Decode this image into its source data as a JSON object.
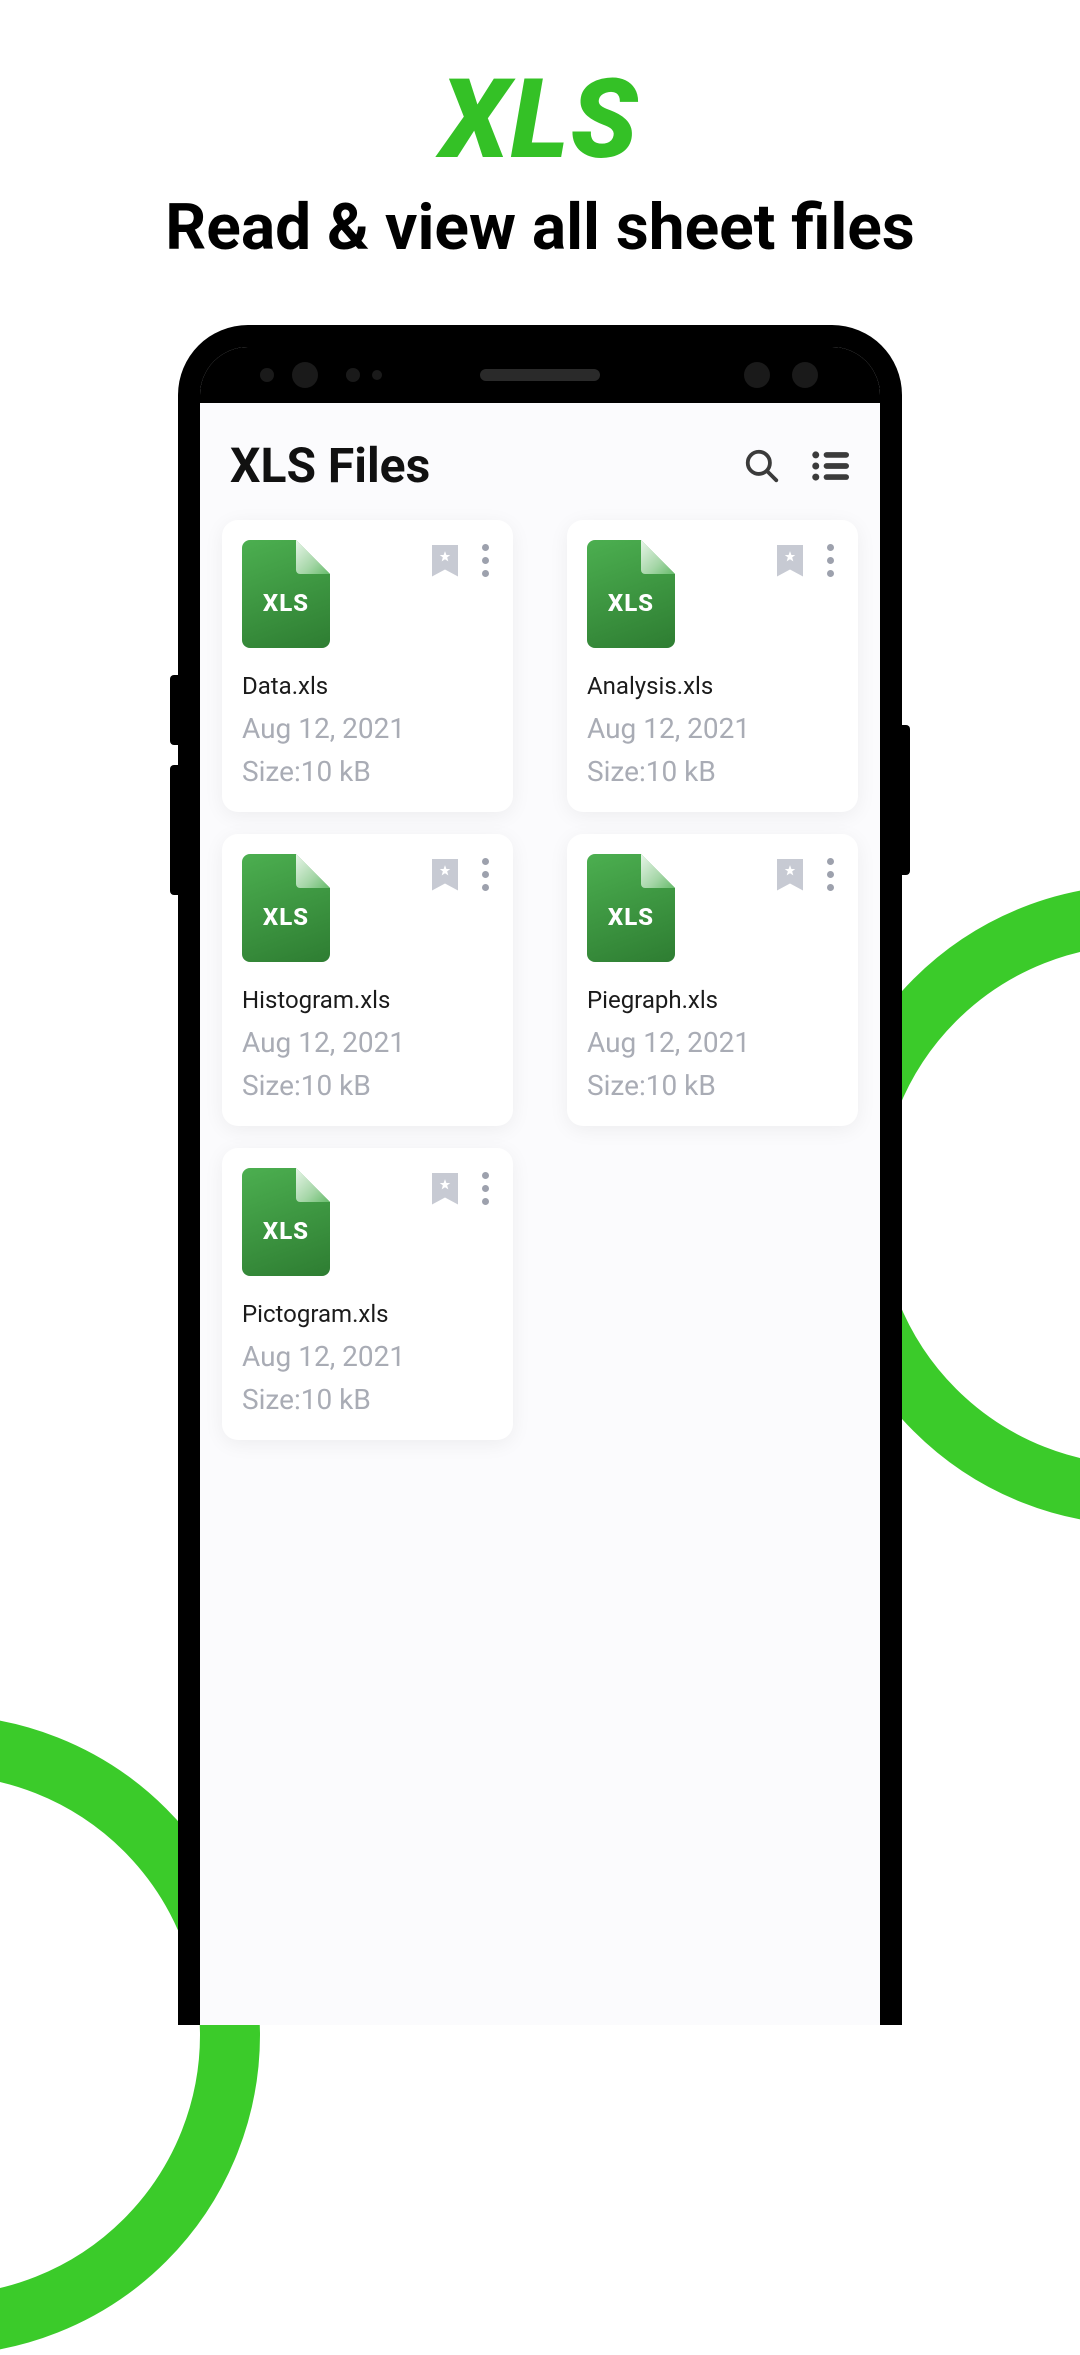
{
  "promo": {
    "title": "XLS",
    "subtitle": "Read & view all sheet files"
  },
  "header": {
    "title": "XLS Files"
  },
  "file_icon_label": "XLS",
  "size_prefix": "Size:",
  "files": [
    {
      "name": "Data.xls",
      "date": "Aug 12, 2021",
      "size": "10 kB"
    },
    {
      "name": "Analysis.xls",
      "date": "Aug 12, 2021",
      "size": "10 kB"
    },
    {
      "name": "Histogram.xls",
      "date": "Aug 12, 2021",
      "size": "10 kB"
    },
    {
      "name": "Piegraph.xls",
      "date": "Aug 12, 2021",
      "size": "10 kB"
    },
    {
      "name": "Pictogram.xls",
      "date": "Aug 12, 2021",
      "size": "10 kB"
    }
  ]
}
